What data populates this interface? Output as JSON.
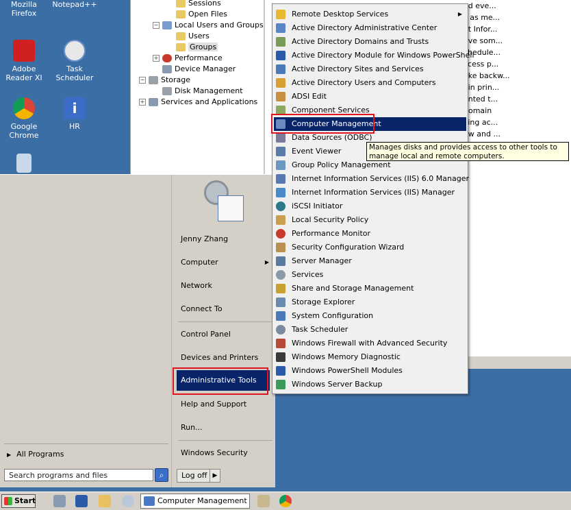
{
  "desktop": {
    "icons": [
      {
        "label": "Mozilla Firefox",
        "icon": "firefox-icon",
        "color": "#e66000"
      },
      {
        "label": "Notepad++",
        "icon": "notepad-plus-icon",
        "color": "#7bbf4a"
      },
      {
        "label": "Adobe Reader XI",
        "icon": "adobe-reader-icon",
        "color": "#d02020"
      },
      {
        "label": "Task Scheduler",
        "icon": "task-scheduler-icon",
        "color": "#6f90c8"
      },
      {
        "label": "Google Chrome",
        "icon": "chrome-icon",
        "color": "#2aa84a"
      },
      {
        "label": "HR",
        "icon": "hr-info-icon",
        "color": "#3a6cc8"
      },
      {
        "label": "",
        "icon": "recycle-bin-icon",
        "color": "#c8d8e8"
      }
    ]
  },
  "mmc": {
    "tree": [
      {
        "label": "Sessions",
        "icon": "folder-icon"
      },
      {
        "label": "Open Files",
        "icon": "folder-icon"
      },
      {
        "label": "Local Users and Groups",
        "icon": "users-groups-icon"
      },
      {
        "label": "Users",
        "icon": "folder-icon"
      },
      {
        "label": "Groups",
        "icon": "folder-icon"
      },
      {
        "label": "Performance",
        "icon": "performance-icon"
      },
      {
        "label": "Device Manager",
        "icon": "device-manager-icon"
      },
      {
        "label": "Storage",
        "icon": "storage-icon"
      },
      {
        "label": "Disk Management",
        "icon": "disk-management-icon"
      },
      {
        "label": "Services and Applications",
        "icon": "services-apps-icon"
      }
    ],
    "descriptions": [
      "ad eve...",
      "s as me...",
      "et Infor...",
      "ave som...",
      "chedule...",
      "ccess p...",
      "ake backw...",
      "ain prin...",
      "anted t...",
      "domain",
      "king ac...",
      "ew and ...",
      "ss"
    ]
  },
  "start_menu": {
    "user_name": "Jenny Zhang",
    "right_items": {
      "computer": "Computer",
      "network": "Network",
      "connect_to": "Connect To",
      "control_panel": "Control Panel",
      "devices_printers": "Devices and Printers",
      "admin_tools": "Administrative Tools",
      "help_support": "Help and Support",
      "run": "Run...",
      "windows_security": "Windows Security"
    },
    "all_programs": "All Programs",
    "search_placeholder": "Search programs and files",
    "logoff": "Log off"
  },
  "admin_tools_menu": {
    "items": [
      {
        "label": "Remote Desktop Services",
        "icon": "folder-icon",
        "color": "#e8b830"
      },
      {
        "label": "Active Directory Administrative Center",
        "icon": "ad-admin-center-icon",
        "color": "#5a86c8"
      },
      {
        "label": "Active Directory Domains and Trusts",
        "icon": "ad-domains-icon",
        "color": "#7a9a5a"
      },
      {
        "label": "Active Directory Module for Windows PowerShell",
        "icon": "powershell-icon",
        "color": "#2a5aa8"
      },
      {
        "label": "Active Directory Sites and Services",
        "icon": "ad-sites-icon",
        "color": "#4a7ab8"
      },
      {
        "label": "Active Directory Users and Computers",
        "icon": "ad-users-icon",
        "color": "#d8a030"
      },
      {
        "label": "ADSI Edit",
        "icon": "adsi-edit-icon",
        "color": "#c89040"
      },
      {
        "label": "Component Services",
        "icon": "component-services-icon",
        "color": "#8aa860"
      },
      {
        "label": "Computer Management",
        "icon": "computer-management-icon",
        "color": "#6a8ac0"
      },
      {
        "label": "Data Sources (ODBC)",
        "icon": "odbc-icon",
        "color": "#7a7a9a"
      },
      {
        "label": "Event Viewer",
        "icon": "event-viewer-icon",
        "color": "#5a7aa8"
      },
      {
        "label": "Group Policy Management",
        "icon": "group-policy-icon",
        "color": "#6a98c0"
      },
      {
        "label": "Internet Information Services (IIS) 6.0 Manager",
        "icon": "iis6-icon",
        "color": "#5a78b0"
      },
      {
        "label": "Internet Information Services (IIS) Manager",
        "icon": "iis-icon",
        "color": "#4a8ac8"
      },
      {
        "label": "iSCSI Initiator",
        "icon": "iscsi-icon",
        "color": "#2a7a8a"
      },
      {
        "label": "Local Security Policy",
        "icon": "security-policy-icon",
        "color": "#c8a050"
      },
      {
        "label": "Performance Monitor",
        "icon": "performance-monitor-icon",
        "color": "#c83a2a"
      },
      {
        "label": "Security Configuration Wizard",
        "icon": "security-wizard-icon",
        "color": "#b89050"
      },
      {
        "label": "Server Manager",
        "icon": "server-manager-icon",
        "color": "#5a7aa0"
      },
      {
        "label": "Services",
        "icon": "services-icon",
        "color": "#8a9aa8"
      },
      {
        "label": "Share and Storage Management",
        "icon": "share-storage-icon",
        "color": "#c8a030"
      },
      {
        "label": "Storage Explorer",
        "icon": "storage-explorer-icon",
        "color": "#6a8ab0"
      },
      {
        "label": "System Configuration",
        "icon": "system-config-icon",
        "color": "#4a7ab8"
      },
      {
        "label": "Task Scheduler",
        "icon": "task-scheduler-icon",
        "color": "#7a8aa0"
      },
      {
        "label": "Windows Firewall with Advanced Security",
        "icon": "firewall-icon",
        "color": "#b84a3a"
      },
      {
        "label": "Windows Memory Diagnostic",
        "icon": "memory-diagnostic-icon",
        "color": "#3a3a3a"
      },
      {
        "label": "Windows PowerShell Modules",
        "icon": "powershell-modules-icon",
        "color": "#2a5aa8"
      },
      {
        "label": "Windows Server Backup",
        "icon": "server-backup-icon",
        "color": "#3a9a5a"
      }
    ],
    "highlight_color": "#0a246a"
  },
  "tooltip": {
    "text": "Manages disks and provides access to other tools to manage local and remote computers."
  },
  "taskbar": {
    "start_label": "Start",
    "active_task": "Computer Management",
    "quick_launch": [
      "server-manager-icon",
      "powershell-icon",
      "explorer-folder-icon",
      "search-tool-icon"
    ],
    "tray_apps": [
      "notepad-icon",
      "chrome-icon"
    ]
  },
  "colors": {
    "desktop": "#3b6ea5",
    "highlight_box": "#e0141e",
    "menu_bg": "#d4d0c8"
  }
}
